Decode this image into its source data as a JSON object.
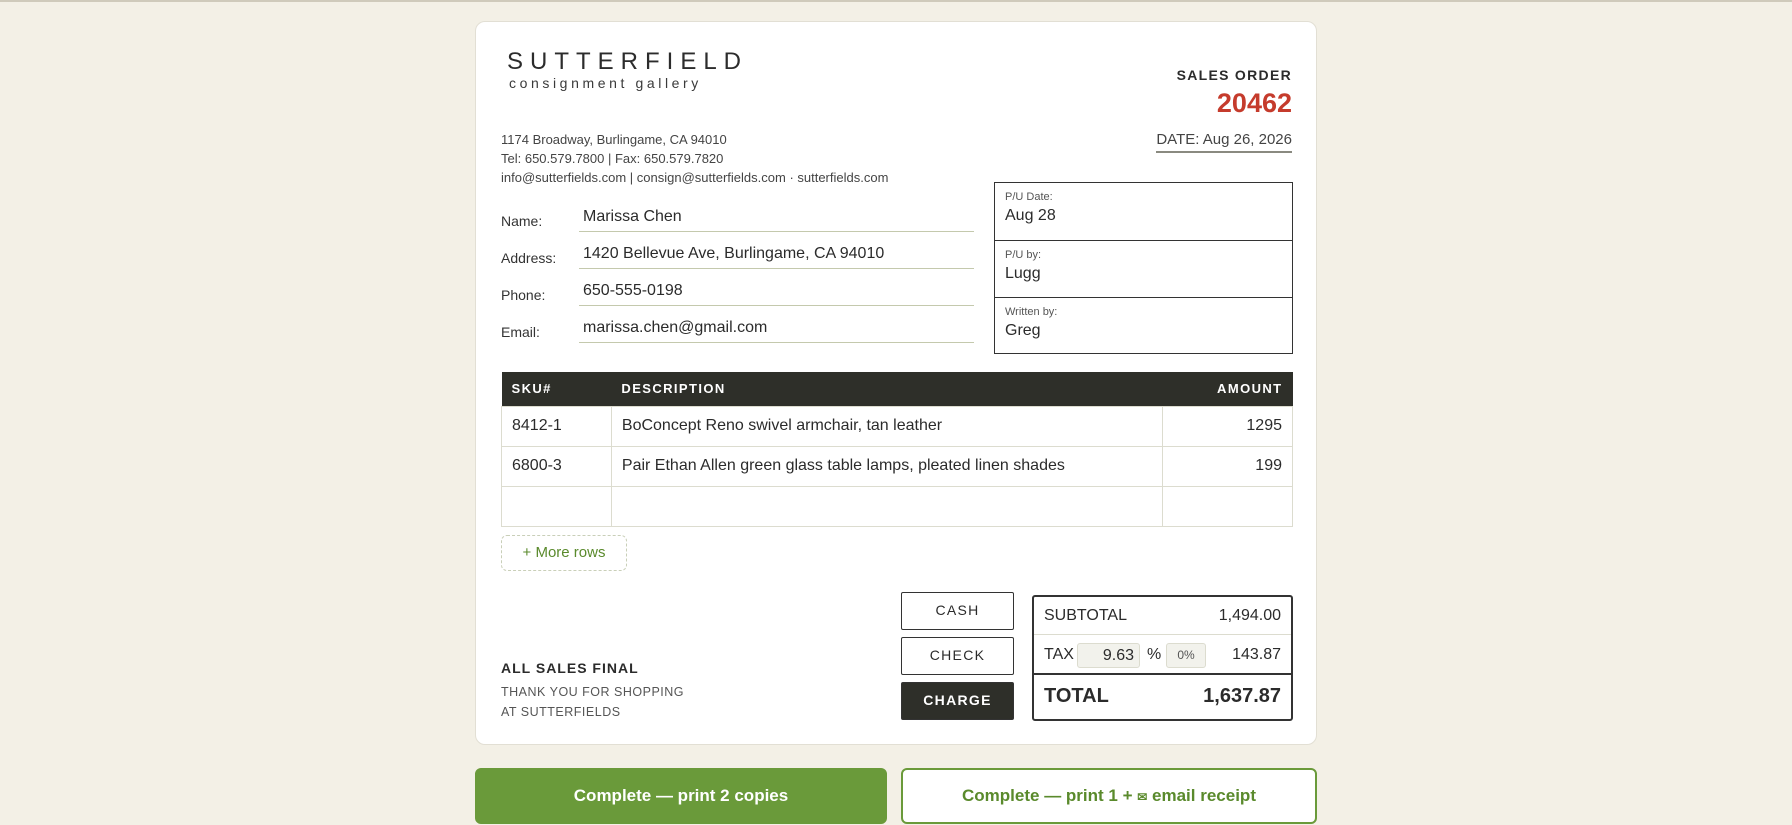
{
  "store": {
    "logo_name": "SUTTERFIELD",
    "logo_sub": "consignment gallery",
    "address": "1174 Broadway, Burlingame, CA 94010",
    "phones": "Tel: 650.579.7800 | Fax: 650.579.7820",
    "web": "info@sutterfields.com | consign@sutterfields.com · sutterfields.com"
  },
  "order": {
    "label": "SALES ORDER",
    "number": "20462",
    "date": "DATE: Aug 26, 2026"
  },
  "customer": {
    "name_label": "Name:",
    "name": "Marissa Chen",
    "address_label": "Address:",
    "address": "1420 Bellevue Ave, Burlingame, CA 94010",
    "phone_label": "Phone:",
    "phone": "650-555-0198",
    "email_label": "Email:",
    "email": "marissa.chen@gmail.com"
  },
  "pickup": {
    "date_label": "P/U Date:",
    "date": "Aug 28",
    "by_label": "P/U by:",
    "by": "Lugg",
    "written_label": "Written by:",
    "written": "Greg"
  },
  "table": {
    "headers": [
      "SKU#",
      "DESCRIPTION",
      "AMOUNT"
    ],
    "rows": [
      {
        "sku": "8412-1",
        "desc": "BoConcept Reno swivel armchair, tan leather",
        "amount": "1295"
      },
      {
        "sku": "6800-3",
        "desc": "Pair Ethan Allen green glass table lamps, pleated linen shades",
        "amount": "199"
      },
      {
        "sku": "",
        "desc": "",
        "amount": ""
      }
    ],
    "more_rows_label": "+ More rows"
  },
  "footer": {
    "sales_final": "ALL SALES FINAL",
    "thanks_line1": "THANK YOU FOR SHOPPING",
    "thanks_line2": "AT SUTTERFIELDS"
  },
  "payment": {
    "cash": "CASH",
    "check": "CHECK",
    "charge": "CHARGE",
    "selected": "CHARGE"
  },
  "totals": {
    "subtotal_label": "SUBTOTAL",
    "subtotal": "1,494.00",
    "tax_label": "TAX",
    "tax_rate": "9.63",
    "tax_pct": "%",
    "tax_zero": "0%",
    "tax": "143.87",
    "total_label": "TOTAL",
    "total": "1,637.87"
  },
  "actions": {
    "primary": "Complete — print 2 copies",
    "secondary_pre": "Complete — print 1 + ",
    "secondary_icon": "✉",
    "secondary_post": " email receipt"
  },
  "colors": {
    "accent_green": "#6a9a3a",
    "order_red": "#c53b2c",
    "header_dark": "#2e2f29",
    "page_bg": "#f3f0e6"
  }
}
